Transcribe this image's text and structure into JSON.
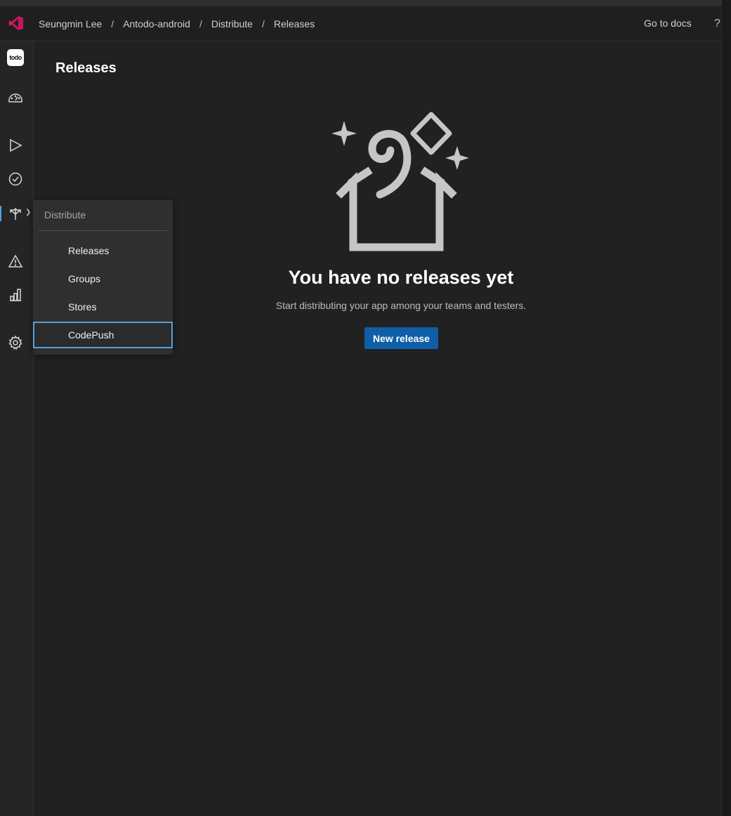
{
  "header": {
    "breadcrumbs": [
      "Seungmin Lee",
      "Antodo-android",
      "Distribute",
      "Releases"
    ],
    "separator": "/",
    "docs_label": "Go to docs",
    "help_label": "?"
  },
  "sidebar": {
    "app_avatar_text": "todo",
    "items": [
      {
        "name": "overview",
        "icon": "speedometer-icon"
      },
      {
        "name": "build",
        "icon": "play-icon"
      },
      {
        "name": "test",
        "icon": "check-circle-icon"
      },
      {
        "name": "distribute",
        "icon": "distribute-arrows-icon",
        "active": true
      },
      {
        "name": "diagnostics",
        "icon": "warning-icon"
      },
      {
        "name": "analytics",
        "icon": "bar-chart-icon"
      },
      {
        "name": "settings",
        "icon": "gear-icon"
      }
    ]
  },
  "flyout": {
    "heading": "Distribute",
    "items": [
      {
        "label": "Releases"
      },
      {
        "label": "Groups"
      },
      {
        "label": "Stores"
      },
      {
        "label": "CodePush",
        "focused": true
      }
    ]
  },
  "main": {
    "title": "Releases",
    "empty_title": "You have no releases yet",
    "empty_subtitle": "Start distributing your app among your teams and testers.",
    "new_release_label": "New release"
  },
  "colors": {
    "accent": "#0f5fa8",
    "focus_ring": "#5a9fd8",
    "brand": "#e0245e",
    "background": "#212121"
  }
}
